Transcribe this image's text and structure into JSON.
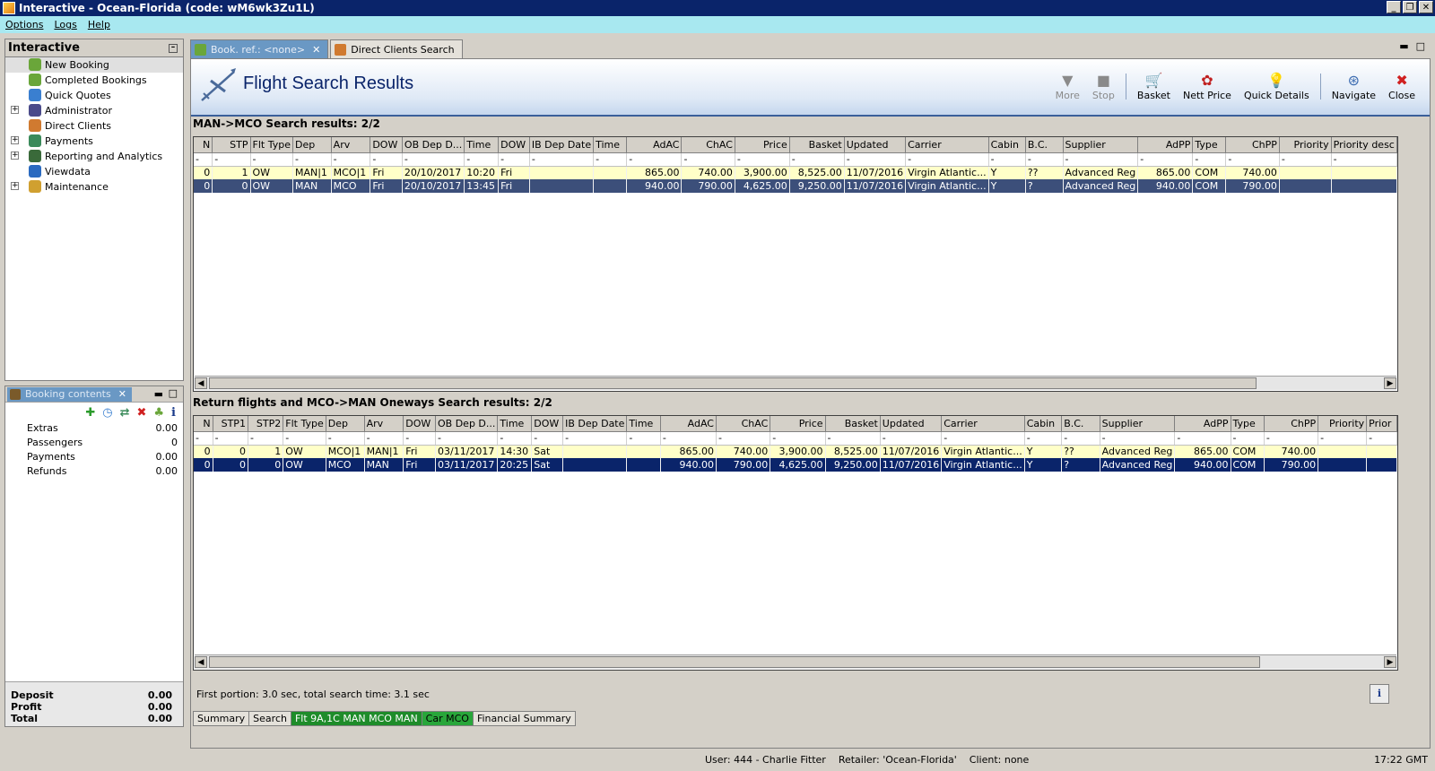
{
  "window": {
    "title": "Interactive - Ocean-Florida (code: wM6wk3Zu1L)"
  },
  "menu": [
    "Options",
    "Logs",
    "Help"
  ],
  "nav_panel": {
    "title": "Interactive",
    "items": [
      {
        "label": "New Booking",
        "expandable": false,
        "icon": "palm-tree-icon",
        "color": "#6aa63a"
      },
      {
        "label": "Completed Bookings",
        "expandable": false,
        "icon": "palm-tree-icon",
        "color": "#6aa63a"
      },
      {
        "label": "Quick Quotes",
        "expandable": false,
        "icon": "clock-icon",
        "color": "#3a7fd0"
      },
      {
        "label": "Administrator",
        "expandable": true,
        "icon": "person-icon",
        "color": "#4a4a8a"
      },
      {
        "label": "Direct Clients",
        "expandable": false,
        "icon": "direct-clients-icon",
        "color": "#d07a30"
      },
      {
        "label": "Payments",
        "expandable": true,
        "icon": "payments-icon",
        "color": "#3a8a5a"
      },
      {
        "label": "Reporting and Analytics",
        "expandable": true,
        "icon": "report-icon",
        "color": "#3a6a3a"
      },
      {
        "label": "Viewdata",
        "expandable": false,
        "icon": "globe-icon",
        "color": "#2a6ac0"
      },
      {
        "label": "Maintenance",
        "expandable": true,
        "icon": "maintenance-icon",
        "color": "#d0a030"
      }
    ]
  },
  "booking_contents": {
    "tab_label": "Booking contents",
    "rows": [
      {
        "label": "Extras",
        "value": "0.00"
      },
      {
        "label": "Passengers",
        "value": "0"
      },
      {
        "label": "Payments",
        "value": "0.00"
      },
      {
        "label": "Refunds",
        "value": "0.00"
      }
    ],
    "totals": [
      {
        "label": "Deposit",
        "value": "0.00"
      },
      {
        "label": "Profit",
        "value": "0.00"
      },
      {
        "label": "Total",
        "value": "0.00"
      }
    ]
  },
  "doc_tabs": [
    {
      "label": "Book. ref.: <none>",
      "active": true
    },
    {
      "label": "Direct Clients Search",
      "active": false
    }
  ],
  "banner": {
    "title": "Flight Search Results"
  },
  "toolbar": [
    {
      "label": "More",
      "icon": "triangle-down-icon",
      "glyph": "▼",
      "enabled": false
    },
    {
      "label": "Stop",
      "icon": "stop-icon",
      "glyph": "■",
      "enabled": false
    },
    {
      "label": "Basket",
      "icon": "basket-icon",
      "glyph": "🛒",
      "enabled": true
    },
    {
      "label": "Nett Price",
      "icon": "nett-price-icon",
      "glyph": "✿",
      "enabled": true
    },
    {
      "label": "Quick Details",
      "icon": "lightbulb-icon",
      "glyph": "💡",
      "enabled": true
    },
    {
      "label": "Navigate",
      "icon": "navigate-icon",
      "glyph": "⊛",
      "enabled": true
    },
    {
      "label": "Close",
      "icon": "close-icon",
      "glyph": "✖",
      "enabled": true
    }
  ],
  "outbound": {
    "label": "MAN->MCO Search results: 2/2",
    "columns": [
      "N",
      "STP",
      "Flt Type",
      "Dep",
      "Arv",
      "DOW",
      "OB Dep D...",
      "Time",
      "DOW",
      "IB Dep Date",
      "Time",
      "AdAC",
      "ChAC",
      "Price",
      "Basket",
      "Updated",
      "Carrier",
      "Cabin",
      "B.C.",
      "Supplier",
      "AdPP",
      "Type",
      "ChPP",
      "Priority",
      "Priority desc"
    ],
    "rows": [
      [
        "0",
        "1",
        "OW",
        "MAN|1",
        "MCO|1",
        "Fri",
        "20/10/2017",
        "10:20",
        "Fri",
        "",
        "",
        "865.00",
        "740.00",
        "3,900.00",
        "8,525.00",
        "11/07/2016",
        "Virgin Atlantic...",
        "Y",
        "??",
        "Advanced Reg",
        "865.00",
        "COM",
        "740.00",
        "",
        ""
      ],
      [
        "0",
        "0",
        "OW",
        "MAN",
        "MCO",
        "Fri",
        "20/10/2017",
        "13:45",
        "Fri",
        "",
        "",
        "940.00",
        "790.00",
        "4,625.00",
        "9,250.00",
        "11/07/2016",
        "Virgin Atlantic...",
        "Y",
        "?",
        "Advanced Reg",
        "940.00",
        "COM",
        "790.00",
        "",
        ""
      ]
    ]
  },
  "return": {
    "label": "Return flights and MCO->MAN Oneways Search results: 2/2",
    "columns": [
      "N",
      "STP1",
      "STP2",
      "Flt Type",
      "Dep",
      "Arv",
      "DOW",
      "OB Dep D...",
      "Time",
      "DOW",
      "IB Dep Date",
      "Time",
      "AdAC",
      "ChAC",
      "Price",
      "Basket",
      "Updated",
      "Carrier",
      "Cabin",
      "B.C.",
      "Supplier",
      "AdPP",
      "Type",
      "ChPP",
      "Priority",
      "Prior"
    ],
    "rows": [
      [
        "0",
        "0",
        "1",
        "OW",
        "MCO|1",
        "MAN|1",
        "Fri",
        "03/11/2017",
        "14:30",
        "Sat",
        "",
        "",
        "865.00",
        "740.00",
        "3,900.00",
        "8,525.00",
        "11/07/2016",
        "Virgin Atlantic...",
        "Y",
        "??",
        "Advanced Reg",
        "865.00",
        "COM",
        "740.00",
        "",
        ""
      ],
      [
        "0",
        "0",
        "0",
        "OW",
        "MCO",
        "MAN",
        "Fri",
        "03/11/2017",
        "20:25",
        "Sat",
        "",
        "",
        "940.00",
        "790.00",
        "4,625.00",
        "9,250.00",
        "11/07/2016",
        "Virgin Atlantic...",
        "Y",
        "?",
        "Advanced Reg",
        "940.00",
        "COM",
        "790.00",
        "",
        ""
      ]
    ]
  },
  "status": {
    "search_time": "First portion: 3.0 sec, total search time: 3.1 sec"
  },
  "bottom_tabs": [
    "Summary",
    "Search",
    "Flt 9A,1C MAN MCO MAN",
    "Car MCO",
    "Financial Summary"
  ],
  "footer": {
    "user": "User: 444 - Charlie Fitter    Retailer: 'Ocean-Florida'    Client: none",
    "time": "17:22 GMT"
  }
}
